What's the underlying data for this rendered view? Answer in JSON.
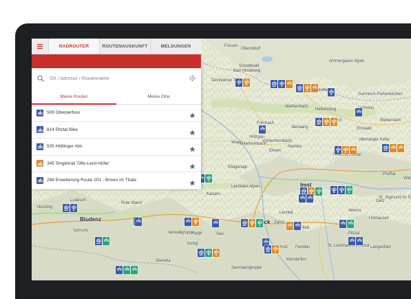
{
  "tabs": {
    "menu_icon": "hamburger-menu-icon",
    "items": [
      "RADROUTER",
      "ROUTENAUSKUNFT",
      "MELDUNGEN"
    ],
    "active": "RADROUTER"
  },
  "search": {
    "placeholder": "Ort / Adresse / Routenname",
    "search_icon": "search-icon",
    "locate_icon": "locate-icon"
  },
  "subtabs": {
    "items": [
      "Meine Routen",
      "Meine Orte"
    ],
    "active": "Meine Routen"
  },
  "routes": [
    {
      "label": "509 Oberperfuss",
      "type": "blue"
    },
    {
      "label": "614 Pitztal Bike",
      "type": "blue"
    },
    {
      "label": "505 Höttinger Alm",
      "type": "blue"
    },
    {
      "label": "345 Singletrail 'Otto-Leixl-Hütte'",
      "type": "orange"
    },
    {
      "label": "288 Erweiterung Route 201 - Brixen im Thale",
      "type": "blue"
    }
  ],
  "map": {
    "places": [
      {
        "text": "Oberstdorf",
        "big": false
      },
      {
        "text": "Bad Hindelang",
        "big": false
      },
      {
        "text": "Schattwald",
        "big": false
      },
      {
        "text": "Füssen",
        "big": false
      },
      {
        "text": "Reutte",
        "big": false
      },
      {
        "text": "Weißenbach",
        "big": false
      },
      {
        "text": "Heiterwang",
        "big": false
      },
      {
        "text": "Lermoos",
        "big": false
      },
      {
        "text": "Ehrwald",
        "big": false
      },
      {
        "text": "Forchach",
        "big": false
      },
      {
        "text": "Warth",
        "big": false
      },
      {
        "text": "Holzgau",
        "big": false
      },
      {
        "text": "Elbigenalp",
        "big": false
      },
      {
        "text": "Vorderhornbach",
        "big": false
      },
      {
        "text": "Hinterhornbach",
        "big": false
      },
      {
        "text": "Berwang",
        "big": false
      },
      {
        "text": "Elmen",
        "big": false
      },
      {
        "text": "Namlos",
        "big": false
      },
      {
        "text": "Mieminger Kette",
        "big": false
      },
      {
        "text": "Holzleitensattel",
        "big": false
      },
      {
        "text": "Wetterstein",
        "big": false
      },
      {
        "text": "Lechtaler Alpen",
        "big": false
      },
      {
        "text": "Kaisers",
        "big": false
      },
      {
        "text": "Imst",
        "big": true
      },
      {
        "text": "Nenzing",
        "big": false
      },
      {
        "text": "Ludesch",
        "big": false
      },
      {
        "text": "Bludenz",
        "big": true
      },
      {
        "text": "Rote Wand",
        "big": false
      },
      {
        "text": "Landeck",
        "big": true
      },
      {
        "text": "Zams",
        "big": false
      },
      {
        "text": "Fließ",
        "big": false
      },
      {
        "text": "Pitztal",
        "big": false
      },
      {
        "text": "Wenns",
        "big": false
      },
      {
        "text": "Schruns",
        "big": false
      },
      {
        "text": "Verwallgruppe",
        "big": false
      },
      {
        "text": "Ischgl",
        "big": false
      },
      {
        "text": "Kappl",
        "big": false
      },
      {
        "text": "See",
        "big": false
      },
      {
        "text": "Prutz",
        "big": false
      },
      {
        "text": "Fendels",
        "big": false
      },
      {
        "text": "Mandarfen",
        "big": false
      },
      {
        "text": "St. Leonhard im Pitztal",
        "big": false
      },
      {
        "text": "Längenfeld",
        "big": false
      },
      {
        "text": "Umhausen",
        "big": false
      },
      {
        "text": "Oetz",
        "big": false
      },
      {
        "text": "St. Sigmund im Sellrain",
        "big": false
      },
      {
        "text": "Silvretta",
        "big": false
      },
      {
        "text": "Samnaungruppe",
        "big": false
      },
      {
        "text": "Garmisch-Partenkirchen",
        "big": false
      },
      {
        "text": "Lechtal",
        "big": false
      },
      {
        "text": "Tannheimer Tal",
        "big": false
      },
      {
        "text": "Pfafflar",
        "big": false
      },
      {
        "text": "Wattens",
        "big": false
      },
      {
        "text": "Ammergauer Alpen",
        "big": false
      }
    ],
    "markers": [
      {
        "colors": [
          "blue",
          "orange"
        ],
        "nums": [
          "7",
          "3"
        ]
      },
      {
        "colors": [
          "blue",
          "blue",
          "orange"
        ],
        "nums": [
          "13",
          "3",
          ""
        ]
      },
      {
        "colors": [
          "blue",
          "orange",
          "orange"
        ],
        "nums": [
          "10",
          "3",
          ""
        ]
      },
      {
        "colors": [
          "blue"
        ],
        "nums": [
          "3"
        ]
      },
      {
        "colors": [
          "blue",
          "orange",
          "orange"
        ],
        "nums": [
          "24",
          "4",
          "2"
        ]
      },
      {
        "colors": [
          "blue"
        ],
        "nums": [
          ""
        ]
      },
      {
        "colors": [
          "blue"
        ],
        "nums": [
          ""
        ]
      },
      {
        "colors": [
          "blue",
          "orange",
          "orange"
        ],
        "nums": [
          "4",
          "2",
          ""
        ]
      },
      {
        "colors": [
          "blue",
          "orange",
          "orange"
        ],
        "nums": [
          "21",
          "",
          ""
        ]
      },
      {
        "colors": [
          "blue",
          "green"
        ],
        "nums": [
          "",
          "1"
        ]
      },
      {
        "colors": [
          "blue",
          "orange",
          "green"
        ],
        "nums": [
          "17",
          "2",
          "4"
        ]
      },
      {
        "colors": [
          "blue",
          "blue",
          "green"
        ],
        "nums": [
          "8",
          "4",
          "1"
        ]
      },
      {
        "colors": [
          "blue",
          "blue"
        ],
        "nums": [
          "15",
          "3"
        ]
      },
      {
        "colors": [
          "blue"
        ],
        "nums": [
          ""
        ]
      },
      {
        "colors": [
          "blue",
          "orange"
        ],
        "nums": [
          "",
          "8"
        ]
      },
      {
        "colors": [
          "blue",
          "orange",
          "green"
        ],
        "nums": [
          "10",
          "4",
          "1"
        ]
      },
      {
        "colors": [
          "orange",
          "blue"
        ],
        "nums": [
          "",
          ""
        ]
      },
      {
        "colors": [
          "blue",
          "green"
        ],
        "nums": [
          "",
          ""
        ]
      },
      {
        "colors": [
          "blue",
          "green",
          "orange"
        ],
        "nums": [
          "10",
          "4",
          "1"
        ]
      },
      {
        "colors": [
          "blue"
        ],
        "nums": [
          ""
        ]
      },
      {
        "colors": [
          "blue",
          "orange"
        ],
        "nums": [
          "21",
          "1"
        ]
      },
      {
        "colors": [
          "blue",
          "green"
        ],
        "nums": [
          "23",
          ""
        ]
      },
      {
        "colors": [
          "blue",
          "green",
          "green"
        ],
        "nums": [
          "",
          "",
          ""
        ]
      },
      {
        "colors": [
          "blue"
        ],
        "nums": [
          ""
        ]
      },
      {
        "colors": [
          "blue"
        ],
        "nums": [
          ""
        ]
      },
      {
        "colors": [
          "blue",
          "blue"
        ],
        "nums": [
          "",
          ""
        ]
      },
      {
        "colors": [
          "blue",
          "blue"
        ],
        "nums": [
          "",
          ""
        ]
      }
    ]
  }
}
